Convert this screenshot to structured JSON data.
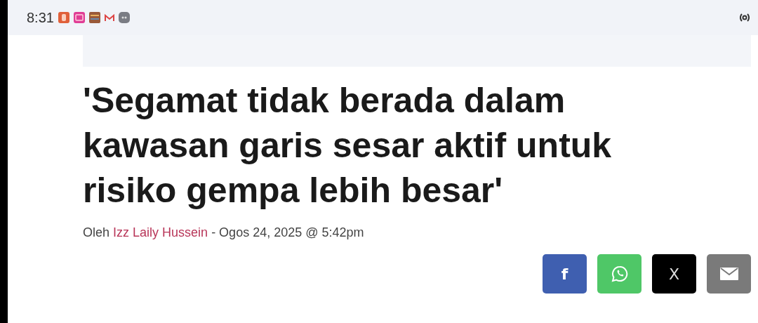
{
  "status_bar": {
    "time": "8:31"
  },
  "article": {
    "headline": "'Segamat tidak berada dalam kawasan garis sesar aktif untuk risiko gempa lebih besar'",
    "byline": {
      "prefix": "Oleh",
      "author": "Izz Laily Hussein",
      "date": "- Ogos 24, 2025 @ 5:42pm"
    }
  },
  "share_buttons": [
    {
      "kind": "facebook",
      "label": "f",
      "color": "#3f5fb0"
    },
    {
      "kind": "whatsapp",
      "color": "#4fc767"
    },
    {
      "kind": "x",
      "label": "X",
      "color": "#000000"
    },
    {
      "kind": "email",
      "color": "#7a7a7a"
    }
  ]
}
